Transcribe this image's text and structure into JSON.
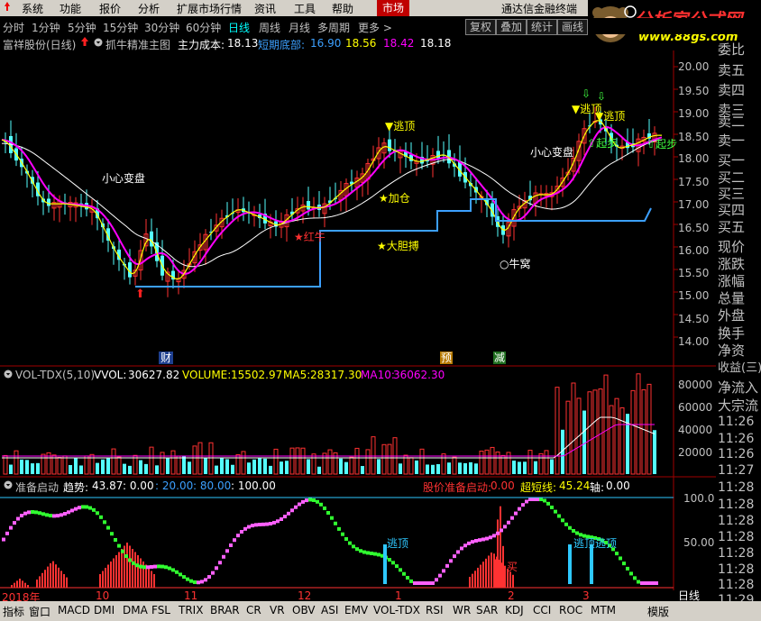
{
  "menu": [
    "系统",
    "功能",
    "报价",
    "分析",
    "扩展市场行情",
    "资讯",
    "工具",
    "帮助",
    "市场",
    "通达信金融终端"
  ],
  "logo": {
    "text": "分析家公式网",
    "url": "www.88gs.com"
  },
  "periods": [
    "分时",
    "1分钟",
    "5分钟",
    "15分钟",
    "30分钟",
    "60分钟",
    "日线",
    "周线",
    "月线",
    "多周期",
    "更多 >"
  ],
  "active_period": "日线",
  "toolbar_buttons": [
    "复权",
    "叠加",
    "统计",
    "画线"
  ],
  "main_info": {
    "stock": "富祥股份(日线)",
    "indicator": "抓牛精准主图",
    "cost_label": "主力成本:",
    "cost_value": "18.13",
    "bottom_label": "短期底部:",
    "bottom_value": "16.90",
    "v3": "18.56",
    "v4": "18.42",
    "v5": "18.18"
  },
  "price_axis": [
    "20.00",
    "19.50",
    "19.00",
    "18.50",
    "18.00",
    "17.50",
    "17.00",
    "16.50",
    "16.00",
    "15.50",
    "15.00",
    "14.50",
    "14.00"
  ],
  "main_annotations": {
    "caution1": "小心变盘",
    "caution2": "小心变盘",
    "escape1": "逃顶",
    "escape2": "逃顶",
    "escape3": "逃顶",
    "add": "加仓",
    "red_bull": "红牛",
    "bold": "大胆搏",
    "bull_nest": "牛窝",
    "start1": "起步",
    "start2": "起步",
    "cai": "财",
    "yu": "预",
    "jian": "减"
  },
  "vol_info": {
    "name": "VOL-TDX(5,10)",
    "vvol_label": "VVOL:",
    "vvol": "30627.82",
    "volume_label": "VOLUME:",
    "volume": "15502.97",
    "ma5_label": "MA5:",
    "ma5": "28317.30",
    "ma10_label": "MA10:",
    "ma10": "36062.30"
  },
  "vol_axis": [
    "80000",
    "60000",
    "40000",
    "20000"
  ],
  "ind_info": {
    "name": "准备启动",
    "trend_label": "趋势:",
    "trend": "43.87",
    "v1": "0.00",
    "v2": "20.00",
    "v3": "80.00",
    "v4": "100.00",
    "price_signal": "股价准备启动:",
    "price_signal_value": "0.00",
    "super_label": "超短线:",
    "super_value": "45.24",
    "axis_label": "轴:",
    "axis_value": "0.00"
  },
  "ind_axis": [
    "100.0",
    "50.00"
  ],
  "ind_annotations": {
    "escape1": "逃顶",
    "escape2": "逃顶",
    "escape3": "逃顶",
    "buy": "买"
  },
  "date_axis": {
    "year": "2018年",
    "m10": "10",
    "m11": "11",
    "m12": "12",
    "m1": "1",
    "m2": "2",
    "m3": "3"
  },
  "right_panel": [
    "委比",
    "卖五",
    "卖四",
    "卖三",
    "卖二",
    "卖一",
    "买一",
    "买二",
    "买三",
    "买四",
    "买五",
    "现价",
    "涨跌",
    "涨幅",
    "总量",
    "外盘",
    "换手",
    "净资",
    "收益(三)",
    "净流入",
    "大宗流"
  ],
  "right_times": [
    "11:26",
    "11:26",
    "11:26",
    "11:27",
    "11:28",
    "11:28",
    "11:28",
    "11:28",
    "11:28",
    "11:28",
    "11:28",
    "11:29"
  ],
  "daily_label": "日线",
  "bottom_tabs": [
    "指标",
    "窗口",
    "MACD",
    "DMI",
    "DMA",
    "FSL",
    "TRIX",
    "BRAR",
    "CR",
    "VR",
    "OBV",
    "ASI",
    "EMV",
    "VOL-TDX",
    "RSI",
    "WR",
    "SAR",
    "KDJ",
    "CCI",
    "ROC",
    "MTM",
    "模版"
  ],
  "colors": {
    "up": "#ff3232",
    "down": "#54ffff",
    "ma5": "#ffff00",
    "ma10": "#ff00ff",
    "cost": "#ffffff",
    "support": "#3ca0ff"
  }
}
